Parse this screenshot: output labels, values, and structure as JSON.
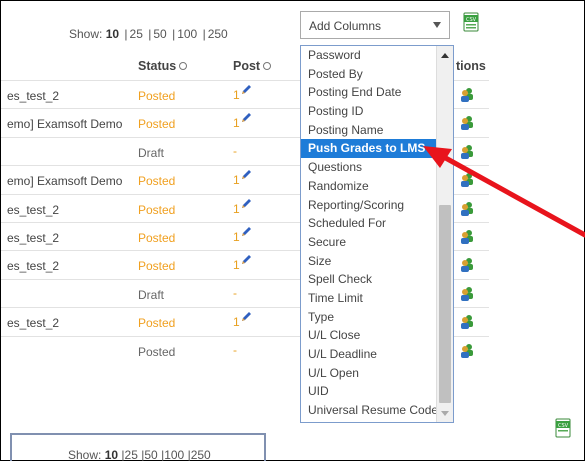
{
  "pagination": {
    "show_label": "Show:",
    "options": [
      "10",
      "25",
      "50",
      "100",
      "250"
    ],
    "active": "10"
  },
  "columns": {
    "status": "Status",
    "post": "Post",
    "partial_actions": "tions"
  },
  "rows": [
    {
      "name": "es_test_2",
      "status": "Posted",
      "post": "1"
    },
    {
      "name": "emo] Examsoft Demo",
      "status": "Posted",
      "post": "1"
    },
    {
      "name": "",
      "status": "Draft",
      "post": "-"
    },
    {
      "name": "emo] Examsoft Demo",
      "status": "Posted",
      "post": "1"
    },
    {
      "name": "es_test_2",
      "status": "Posted",
      "post": "1"
    },
    {
      "name": "es_test_2",
      "status": "Posted",
      "post": "1"
    },
    {
      "name": "es_test_2",
      "status": "Posted",
      "post": "1"
    },
    {
      "name": "",
      "status": "Draft",
      "post": "-"
    },
    {
      "name": "es_test_2",
      "status": "Posted",
      "post": "1"
    },
    {
      "name": "",
      "status": "Posted",
      "post": "-"
    }
  ],
  "add_columns": {
    "label": "Add Columns",
    "items": [
      "Password",
      "Posted By",
      "Posting End Date",
      "Posting ID",
      "Posting Name",
      "Push Grades to LMS",
      "Questions",
      "Randomize",
      "Reporting/Scoring",
      "Scheduled For",
      "Secure",
      "Size",
      "Spell Check",
      "Time Limit",
      "Type",
      "U/L Close",
      "U/L Deadline",
      "U/L Open",
      "UID",
      "Universal Resume Code"
    ],
    "highlighted": "Push Grades to LMS"
  },
  "colors": {
    "posted": "#f0a020",
    "highlight": "#1e7cd8",
    "arrow": "#e8141c"
  }
}
